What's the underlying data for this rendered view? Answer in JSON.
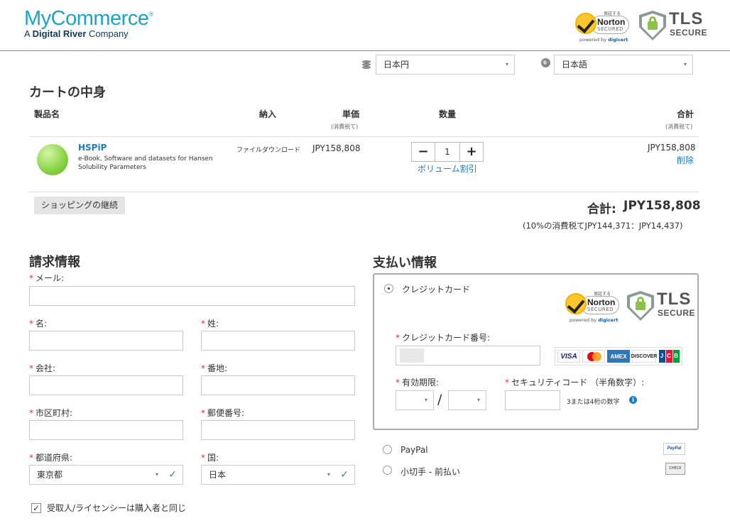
{
  "brand": {
    "name": "MyCommerce",
    "reg": "®",
    "tagline_prefix": "A ",
    "tagline_bold": "Digital River",
    "tagline_suffix": " Company"
  },
  "badges": {
    "norton_top": "保証する",
    "norton_name": "Norton",
    "norton_secured": "SECURED",
    "powered": "powered by ",
    "digicert": "digicert",
    "tls_1": "TLS",
    "tls_2": "SECURE"
  },
  "selectors": {
    "currency": "日本円",
    "language": "日本語"
  },
  "cart": {
    "title": "カートの中身",
    "col_product": "製品名",
    "col_delivery": "納入",
    "col_unit": "単価",
    "col_unit_sub": "(消費税て)",
    "col_qty": "数量",
    "col_total": "合計",
    "col_total_sub": "(消費税て)",
    "item": {
      "name": "HSPiP",
      "desc_1": "e-Book, Software and datasets for Hansen",
      "desc_2": "Solubility Parameters",
      "delivery": "ファイルダウンロード",
      "unit_price": "JPY158,808",
      "qty": "1",
      "minus": "−",
      "plus": "+",
      "volume_discount": "ボリューム割引",
      "total": "JPY158,808",
      "remove": "削除"
    },
    "continue_shopping": "ショッピングの継続",
    "grand_total_label": "合計:",
    "grand_total": "JPY158,808",
    "tax_note": "(10%の消費税てJPY144,371：JPY14,437)"
  },
  "billing": {
    "title": "請求情報",
    "req": "*",
    "email": "メール:",
    "first_name": "名:",
    "last_name": "姓:",
    "company": "会社:",
    "address": "番地:",
    "city": "市区町村:",
    "postal": "郵便番号:",
    "prefecture": "都道府県:",
    "prefecture_value": "東京都",
    "country": "国:",
    "country_value": "日本",
    "same_as_buyer": "受取人/ライセンシーは購入者と同じ",
    "check": "✓",
    "arrow": "▾"
  },
  "payment": {
    "title": "支払い情報",
    "credit_card": "クレジットカード",
    "card_number": "クレジットカード番号:",
    "expiry": "有効期限:",
    "slash": "/",
    "security_code": "セキュリティコード （半角数字）:",
    "security_hint": "3または4桁の数字",
    "info": "i",
    "paypal": "PayPal",
    "check_prepay": "小切手 - 前払い",
    "cards": {
      "visa": "VISA",
      "amex": "AMEX",
      "discover": "DISCOVER",
      "jcb": [
        "J",
        "C",
        "B"
      ]
    },
    "paypal_icon": "PayPal",
    "check_icon": "CHECK"
  }
}
